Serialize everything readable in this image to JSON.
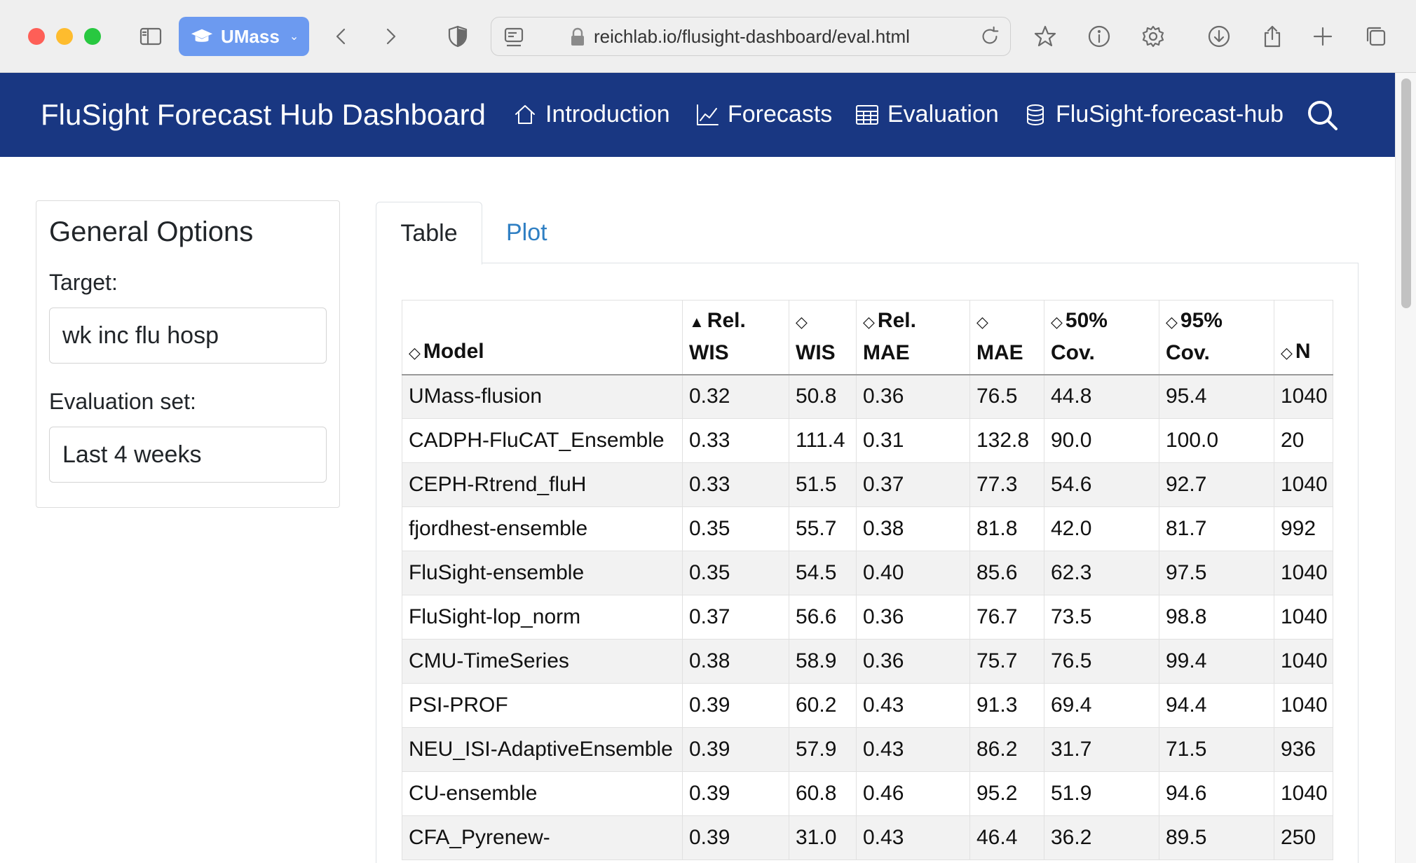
{
  "browser": {
    "profile_label": "UMass",
    "url": "reichlab.io/flusight-dashboard/eval.html"
  },
  "navbar": {
    "brand": "FluSight Forecast Hub Dashboard",
    "items": [
      {
        "label": "Introduction",
        "icon": "house-icon"
      },
      {
        "label": "Forecasts",
        "icon": "line-chart-icon"
      },
      {
        "label": "Evaluation",
        "icon": "table-icon"
      },
      {
        "label": "FluSight-forecast-hub",
        "icon": "database-icon"
      }
    ]
  },
  "sidebar": {
    "title": "General Options",
    "target_label": "Target:",
    "target_value": "wk inc flu hosp",
    "eval_label": "Evaluation set:",
    "eval_value": "Last 4 weeks"
  },
  "tabs": [
    {
      "label": "Table",
      "active": true
    },
    {
      "label": "Plot",
      "active": false
    }
  ],
  "table": {
    "columns": [
      {
        "line1": "",
        "line2": "Model",
        "sort": "◇"
      },
      {
        "line1": "Rel.",
        "line2": "WIS",
        "sort": "▲"
      },
      {
        "line1": "",
        "line2": "WIS",
        "sort": "◇"
      },
      {
        "line1": "Rel.",
        "line2": "MAE",
        "sort": "◇"
      },
      {
        "line1": "",
        "line2": "MAE",
        "sort": "◇"
      },
      {
        "line1": "50%",
        "line2": "Cov.",
        "sort": "◇"
      },
      {
        "line1": "95%",
        "line2": "Cov.",
        "sort": "◇"
      },
      {
        "line1": "",
        "line2": "N",
        "sort": "◇"
      }
    ],
    "rows": [
      [
        "UMass-flusion",
        "0.32",
        "50.8",
        "0.36",
        "76.5",
        "44.8",
        "95.4",
        "1040"
      ],
      [
        "CADPH-FluCAT_Ensemble",
        "0.33",
        "111.4",
        "0.31",
        "132.8",
        "90.0",
        "100.0",
        "20"
      ],
      [
        "CEPH-Rtrend_fluH",
        "0.33",
        "51.5",
        "0.37",
        "77.3",
        "54.6",
        "92.7",
        "1040"
      ],
      [
        "fjordhest-ensemble",
        "0.35",
        "55.7",
        "0.38",
        "81.8",
        "42.0",
        "81.7",
        "992"
      ],
      [
        "FluSight-ensemble",
        "0.35",
        "54.5",
        "0.40",
        "85.6",
        "62.3",
        "97.5",
        "1040"
      ],
      [
        "FluSight-lop_norm",
        "0.37",
        "56.6",
        "0.36",
        "76.7",
        "73.5",
        "98.8",
        "1040"
      ],
      [
        "CMU-TimeSeries",
        "0.38",
        "58.9",
        "0.36",
        "75.7",
        "76.5",
        "99.4",
        "1040"
      ],
      [
        "PSI-PROF",
        "0.39",
        "60.2",
        "0.43",
        "91.3",
        "69.4",
        "94.4",
        "1040"
      ],
      [
        "NEU_ISI-AdaptiveEnsemble",
        "0.39",
        "57.9",
        "0.43",
        "86.2",
        "31.7",
        "71.5",
        "936"
      ],
      [
        "CU-ensemble",
        "0.39",
        "60.8",
        "0.46",
        "95.2",
        "51.9",
        "94.6",
        "1040"
      ],
      [
        "CFA_Pyrenew-",
        "0.39",
        "31.0",
        "0.43",
        "46.4",
        "36.2",
        "89.5",
        "250"
      ]
    ]
  }
}
